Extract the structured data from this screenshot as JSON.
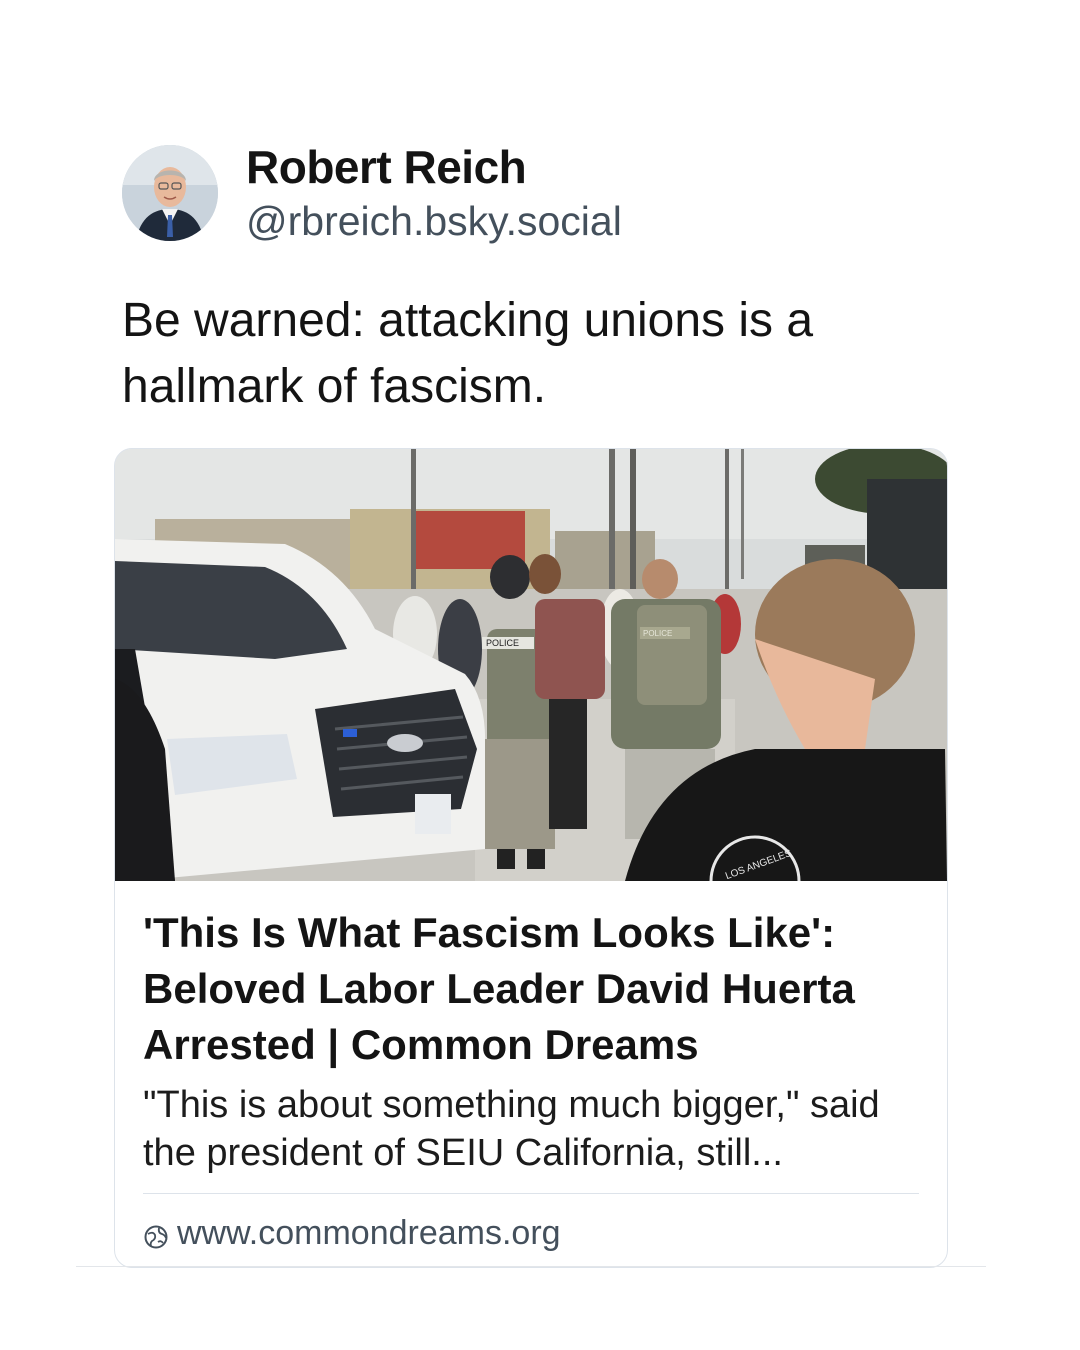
{
  "post": {
    "author": {
      "display_name": "Robert Reich",
      "handle": "@rbreich.bsky.social"
    },
    "text": "Be warned: attacking unions is a hallmark of fascism.",
    "link_card": {
      "title": "'This Is What Fascism Looks Like': Beloved Labor Leader David Huerta Arrested | Common Dreams",
      "description": "\"This is about something much bigger,\" said the president of SEIU California, still...",
      "domain": "www.commondreams.org",
      "domain_icon": "globe-icon",
      "image_labels": {
        "vest_left": "POLICE",
        "vest_right": "POLICE",
        "shirt": "LOS ANGELES"
      }
    }
  },
  "colors": {
    "text": "#141414",
    "handle": "#44505c",
    "border": "#dde3ea"
  }
}
